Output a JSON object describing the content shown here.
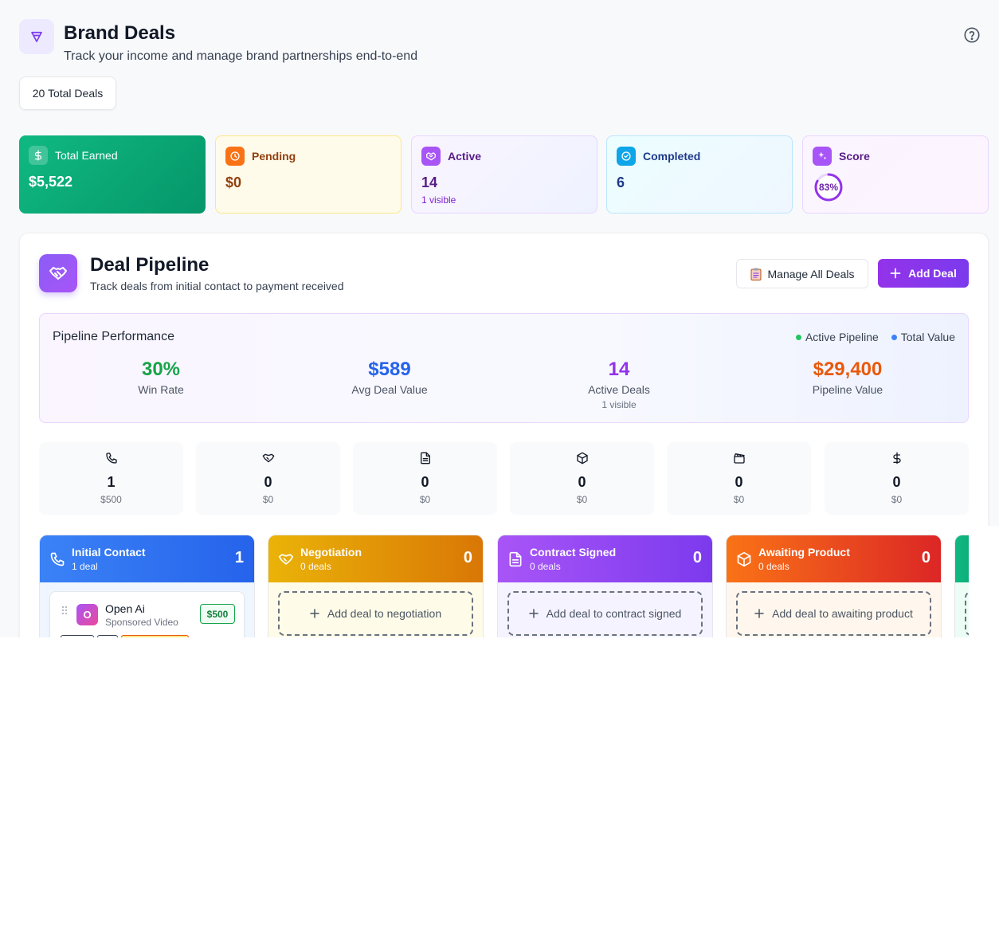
{
  "header": {
    "title": "Brand Deals",
    "subtitle": "Track your income and manage brand partnerships end-to-end",
    "total_deals": "20 Total Deals"
  },
  "stats": {
    "earned": {
      "label": "Total Earned",
      "value": "$5,522"
    },
    "pending": {
      "label": "Pending",
      "value": "$0"
    },
    "active": {
      "label": "Active",
      "value": "14",
      "note": "1 visible"
    },
    "completed": {
      "label": "Completed",
      "value": "6"
    },
    "score": {
      "label": "Score",
      "value": "83%",
      "fraction": 0.83
    }
  },
  "pipeline": {
    "title": "Deal Pipeline",
    "subtitle": "Track deals from initial contact to payment received",
    "manage_label": "Manage All Deals",
    "add_label": "Add Deal"
  },
  "performance": {
    "title": "Pipeline Performance",
    "legend": [
      "Active Pipeline",
      "Total Value"
    ],
    "metrics": [
      {
        "value": "30%",
        "label": "Win Rate",
        "color": "#16a34a"
      },
      {
        "value": "$589",
        "label": "Avg Deal Value",
        "color": "#2563eb"
      },
      {
        "value": "14",
        "label": "Active Deals",
        "note": "1 visible",
        "color": "#9333ea"
      },
      {
        "value": "$29,400",
        "label": "Pipeline Value",
        "color": "#ea580c"
      }
    ]
  },
  "stage_tiles": [
    {
      "icon": "phone-icon",
      "count": "1",
      "value": "$500"
    },
    {
      "icon": "handshake-icon",
      "count": "0",
      "value": "$0"
    },
    {
      "icon": "document-icon",
      "count": "0",
      "value": "$0"
    },
    {
      "icon": "package-icon",
      "count": "0",
      "value": "$0"
    },
    {
      "icon": "clapperboard-icon",
      "count": "0",
      "value": "$0"
    },
    {
      "icon": "dollar-icon",
      "count": "0",
      "value": "$0"
    }
  ],
  "columns": [
    {
      "name": "Initial Contact",
      "sub": "1 deal",
      "count": "1"
    },
    {
      "name": "Negotiation",
      "sub": "0 deals",
      "count": "0",
      "add": "Add deal to negotiation"
    },
    {
      "name": "Contract Signed",
      "sub": "0 deals",
      "count": "0",
      "add": "Add deal to contract signed"
    },
    {
      "name": "Awaiting Product",
      "sub": "0 deals",
      "count": "0",
      "add": "Add deal to awaiting product"
    }
  ],
  "deal_card": {
    "initial": "O",
    "name": "Open Ai",
    "type": "Sponsored Video",
    "amount": "$500"
  },
  "colors": {
    "accent": "#7c3aed",
    "active_pipeline_dot": "#22c55e",
    "total_value_dot": "#3b82f6"
  }
}
